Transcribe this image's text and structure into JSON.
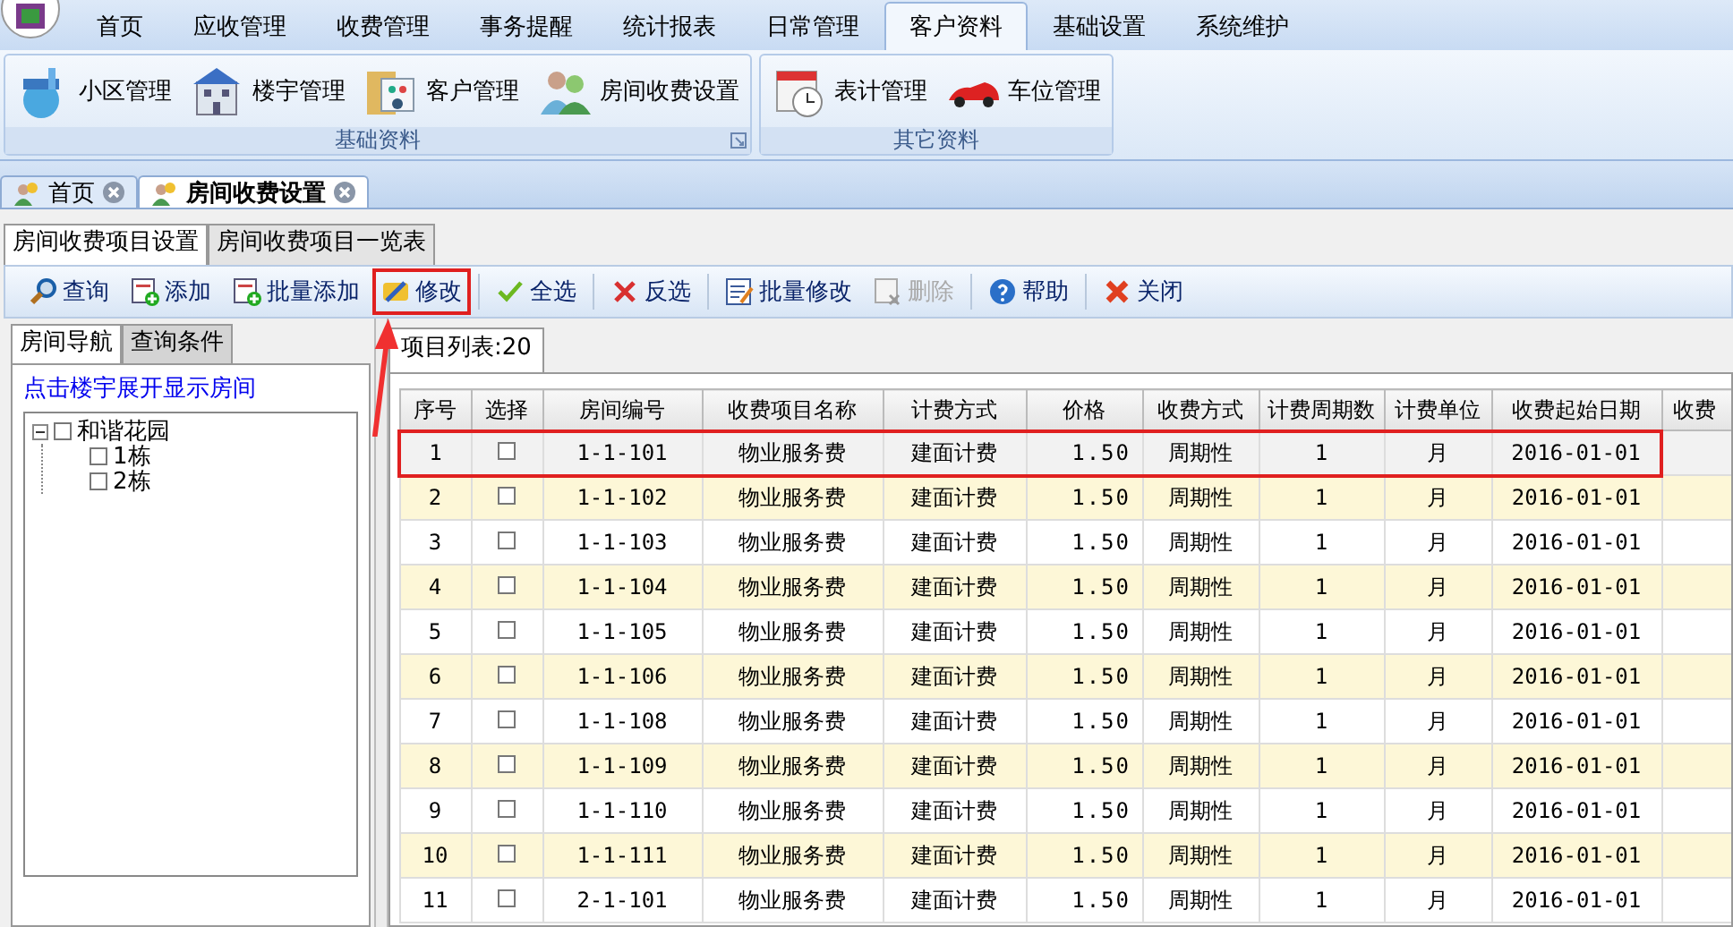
{
  "menu": [
    {
      "label": "首页",
      "selected": false
    },
    {
      "label": "应收管理",
      "selected": false
    },
    {
      "label": "收费管理",
      "selected": false
    },
    {
      "label": "事务提醒",
      "selected": false
    },
    {
      "label": "统计报表",
      "selected": false
    },
    {
      "label": "日常管理",
      "selected": false
    },
    {
      "label": "客户资料",
      "selected": true
    },
    {
      "label": "基础设置",
      "selected": false
    },
    {
      "label": "系统维护",
      "selected": false
    }
  ],
  "ribbon_groups": [
    {
      "title": "基础资料",
      "buttons": [
        {
          "label": "小区管理",
          "kind": "park"
        },
        {
          "label": "楼宇管理",
          "kind": "building"
        },
        {
          "label": "客户管理",
          "kind": "folder"
        },
        {
          "label": "房间收费设置",
          "kind": "people"
        }
      ]
    },
    {
      "title": "其它资料",
      "buttons": [
        {
          "label": "表计管理",
          "kind": "clock"
        },
        {
          "label": "车位管理",
          "kind": "car"
        }
      ]
    }
  ],
  "doc_tabs": [
    {
      "label": "首页",
      "selected": false
    },
    {
      "label": "房间收费设置",
      "selected": true
    }
  ],
  "page_tabs": [
    {
      "label": "房间收费项目设置",
      "selected": true
    },
    {
      "label": "房间收费项目一览表",
      "selected": false
    }
  ],
  "toolbar": [
    {
      "label": "查询",
      "kind": "search",
      "disabled": false,
      "marked": false
    },
    {
      "label": "添加",
      "kind": "add",
      "disabled": false,
      "marked": false
    },
    {
      "label": "批量添加",
      "kind": "add",
      "disabled": false,
      "marked": false
    },
    {
      "label": "修改",
      "kind": "edit",
      "disabled": false,
      "marked": true
    },
    {
      "label": "全选",
      "kind": "check",
      "disabled": false,
      "marked": false
    },
    {
      "label": "反选",
      "kind": "cross",
      "disabled": false,
      "marked": false
    },
    {
      "label": "批量修改",
      "kind": "form",
      "disabled": false,
      "marked": false
    },
    {
      "label": "删除",
      "kind": "delete",
      "disabled": true,
      "marked": false
    },
    {
      "label": "帮助",
      "kind": "help",
      "disabled": false,
      "marked": false
    },
    {
      "label": "关闭",
      "kind": "close",
      "disabled": false,
      "marked": false
    }
  ],
  "side_tabs": [
    {
      "label": "房间导航",
      "selected": true
    },
    {
      "label": "查询条件",
      "selected": false
    }
  ],
  "hint_link": "点击楼宇展开显示房间",
  "tree": [
    {
      "label": "和谐花园",
      "checked": false,
      "expanded": true,
      "children": [
        {
          "label": "1栋",
          "checked": false
        },
        {
          "label": "2栋",
          "checked": false
        }
      ]
    }
  ],
  "list_tab": "项目列表:20",
  "table": {
    "columns": [
      "序号",
      "选择",
      "房间编号",
      "收费项目名称",
      "计费方式",
      "价格",
      "收费方式",
      "计费周期数",
      "计费单位",
      "收费起始日期",
      "收费"
    ],
    "rows": [
      {
        "no": "1",
        "checked": false,
        "room": "1-1-101",
        "item": "物业服务费",
        "method": "建面计费",
        "price": "1.50",
        "mode": "周期性",
        "cycles": "1",
        "unit": "月",
        "start": "2016-01-01",
        "selected": true,
        "marked": true
      },
      {
        "no": "2",
        "checked": false,
        "room": "1-1-102",
        "item": "物业服务费",
        "method": "建面计费",
        "price": "1.50",
        "mode": "周期性",
        "cycles": "1",
        "unit": "月",
        "start": "2016-01-01",
        "selected": false,
        "marked": false
      },
      {
        "no": "3",
        "checked": false,
        "room": "1-1-103",
        "item": "物业服务费",
        "method": "建面计费",
        "price": "1.50",
        "mode": "周期性",
        "cycles": "1",
        "unit": "月",
        "start": "2016-01-01",
        "selected": false,
        "marked": false
      },
      {
        "no": "4",
        "checked": false,
        "room": "1-1-104",
        "item": "物业服务费",
        "method": "建面计费",
        "price": "1.50",
        "mode": "周期性",
        "cycles": "1",
        "unit": "月",
        "start": "2016-01-01",
        "selected": false,
        "marked": false
      },
      {
        "no": "5",
        "checked": false,
        "room": "1-1-105",
        "item": "物业服务费",
        "method": "建面计费",
        "price": "1.50",
        "mode": "周期性",
        "cycles": "1",
        "unit": "月",
        "start": "2016-01-01",
        "selected": false,
        "marked": false
      },
      {
        "no": "6",
        "checked": false,
        "room": "1-1-106",
        "item": "物业服务费",
        "method": "建面计费",
        "price": "1.50",
        "mode": "周期性",
        "cycles": "1",
        "unit": "月",
        "start": "2016-01-01",
        "selected": false,
        "marked": false
      },
      {
        "no": "7",
        "checked": false,
        "room": "1-1-108",
        "item": "物业服务费",
        "method": "建面计费",
        "price": "1.50",
        "mode": "周期性",
        "cycles": "1",
        "unit": "月",
        "start": "2016-01-01",
        "selected": false,
        "marked": false
      },
      {
        "no": "8",
        "checked": false,
        "room": "1-1-109",
        "item": "物业服务费",
        "method": "建面计费",
        "price": "1.50",
        "mode": "周期性",
        "cycles": "1",
        "unit": "月",
        "start": "2016-01-01",
        "selected": false,
        "marked": false
      },
      {
        "no": "9",
        "checked": false,
        "room": "1-1-110",
        "item": "物业服务费",
        "method": "建面计费",
        "price": "1.50",
        "mode": "周期性",
        "cycles": "1",
        "unit": "月",
        "start": "2016-01-01",
        "selected": false,
        "marked": false
      },
      {
        "no": "10",
        "checked": false,
        "room": "1-1-111",
        "item": "物业服务费",
        "method": "建面计费",
        "price": "1.50",
        "mode": "周期性",
        "cycles": "1",
        "unit": "月",
        "start": "2016-01-01",
        "selected": false,
        "marked": false
      },
      {
        "no": "11",
        "checked": false,
        "room": "2-1-101",
        "item": "物业服务费",
        "method": "建面计费",
        "price": "1.50",
        "mode": "周期性",
        "cycles": "1",
        "unit": "月",
        "start": "2016-01-01",
        "selected": false,
        "marked": false
      }
    ]
  }
}
